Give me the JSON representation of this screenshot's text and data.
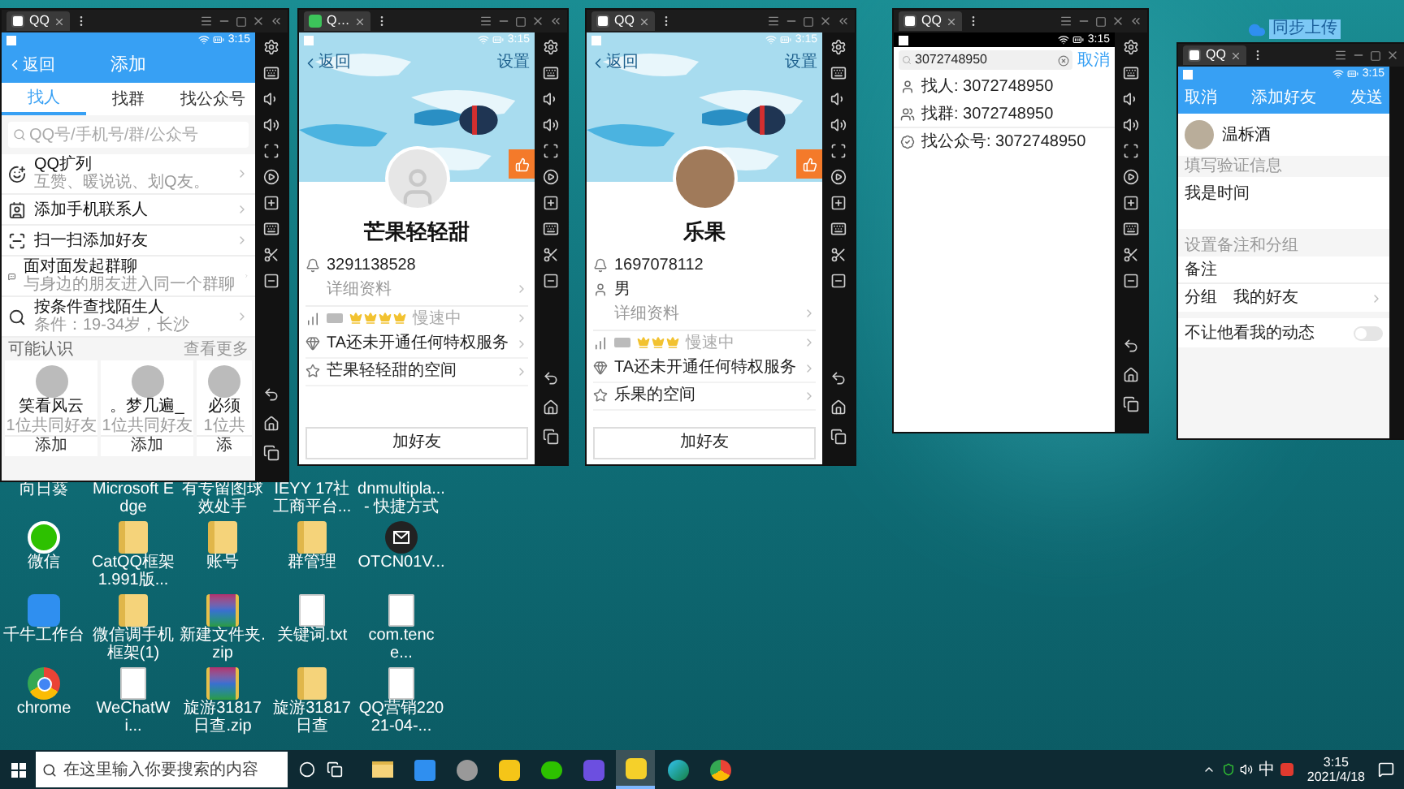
{
  "sync_button": {
    "label": "同步上传"
  },
  "windows": [
    {
      "kind": "add",
      "tab": "QQ",
      "app_icon": {
        "kind": "qq"
      },
      "time": "3:15",
      "back": "返回",
      "title": "添加",
      "tabs": [
        {
          "label": "找人",
          "selected": true
        },
        {
          "label": "找群",
          "selected": false
        },
        {
          "label": "找公众号",
          "selected": false
        }
      ],
      "search_placeholder": "QQ号/手机号/群/公众号",
      "items": [
        {
          "kind": "expand",
          "title": "QQ扩列",
          "subtitle": "互赞、暖说说、划Q友。"
        },
        {
          "kind": "contacts",
          "title": "添加手机联系人"
        },
        {
          "kind": "scan",
          "title": "扫一扫添加好友"
        },
        {
          "kind": "chat",
          "title": "面对面发起群聊",
          "subtitle": "与身边的朋友进入同一个群聊"
        },
        {
          "kind": "search",
          "title": "按条件查找陌生人",
          "subtitle": "条件：19-34岁，长沙"
        }
      ],
      "section": "可能认识",
      "more": "查看更多",
      "people": [
        {
          "name": "笑看风云",
          "mutual": "1位共同好友",
          "action": "添加"
        },
        {
          "name": "。梦几遍_",
          "mutual": "1位共同好友",
          "action": "添加"
        },
        {
          "name": "必须",
          "mutual": "1位共",
          "action": "添"
        }
      ]
    },
    {
      "kind": "profile",
      "tab": "Q…",
      "app_icon": {
        "kind": "green"
      },
      "time": "3:15",
      "back": "返回",
      "settings": "设置",
      "name": "芒果轻轻甜",
      "avatar": {
        "kind": "default"
      },
      "info": [
        {
          "kind": "qq",
          "text": "3291138528"
        },
        {
          "kind": "detail",
          "text": "详细资料"
        }
      ],
      "level": {
        "stars": 4,
        "status": "慢速中"
      },
      "links": [
        {
          "kind": "privilege",
          "text": "TA还未开通任何特权服务"
        },
        {
          "kind": "space",
          "text": "芒果轻轻甜的空间"
        }
      ],
      "add_button": "加好友"
    },
    {
      "kind": "profile",
      "tab": "QQ",
      "app_icon": {
        "kind": "qq"
      },
      "time": "3:15",
      "back": "返回",
      "settings": "设置",
      "name": "乐果",
      "avatar": {
        "kind": "photo"
      },
      "info": [
        {
          "kind": "qq",
          "text": "1697078112"
        },
        {
          "kind": "gender",
          "text": "男"
        },
        {
          "kind": "detail",
          "text": "详细资料"
        }
      ],
      "level": {
        "stars": 3,
        "status": "慢速中"
      },
      "links": [
        {
          "kind": "privilege",
          "text": "TA还未开通任何特权服务"
        },
        {
          "kind": "space",
          "text": "乐果的空间"
        }
      ],
      "add_button": "加好友"
    },
    {
      "kind": "search",
      "tab": "QQ",
      "app_icon": {
        "kind": "qq"
      },
      "time": "3:15",
      "query": "3072748950",
      "cancel": "取消",
      "results": [
        {
          "kind": "person",
          "text": "找人: 3072748950"
        },
        {
          "kind": "group",
          "text": "找群: 3072748950"
        },
        {
          "kind": "official",
          "text": "找公众号: 3072748950"
        }
      ]
    },
    {
      "kind": "add_friend",
      "tab": "QQ",
      "app_icon": {
        "kind": "qq"
      },
      "time": "3:15",
      "cancel": "取消",
      "title": "添加好友",
      "send": "发送",
      "name": "温柝酒",
      "verify_label": "填写验证信息",
      "verify_text": "我是时间",
      "group_label": "设置备注和分组",
      "remark": "备注",
      "group_key": "分组",
      "group_value": "我的好友",
      "hide_label": "不让他看我的动态",
      "hide_on": false
    }
  ],
  "desktop_icons": [
    {
      "label": "向日葵",
      "kind": "covered"
    },
    {
      "label": "Microsoft Edge",
      "kind": "covered"
    },
    {
      "label": "有专留图球效处手",
      "kind": "covered"
    },
    {
      "label": "IEYY 17社工商平台...",
      "kind": "covered"
    },
    {
      "label": "dnmultipla... - 快捷方式",
      "kind": "covered"
    },
    {
      "label": "微信",
      "kind": "wechat"
    },
    {
      "label": "CatQQ框架1.991版...",
      "kind": "folder"
    },
    {
      "label": "账号",
      "kind": "folder"
    },
    {
      "label": "群管理",
      "kind": "folder"
    },
    {
      "label": "OTCN01V...",
      "kind": "mail"
    },
    {
      "label": "千牛工作台",
      "kind": "app"
    },
    {
      "label": "微信调手机框架(1)",
      "kind": "folder"
    },
    {
      "label": "新建文件夹.zip",
      "kind": "archive"
    },
    {
      "label": "关键词.txt",
      "kind": "file"
    },
    {
      "label": "com.tence...",
      "kind": "file"
    },
    {
      "label": "chrome",
      "kind": "browser"
    },
    {
      "label": "WeChatWi...",
      "kind": "file"
    },
    {
      "label": "旋游31817日查.zip",
      "kind": "archive"
    },
    {
      "label": "旋游31817日查",
      "kind": "folder"
    },
    {
      "label": "QQ营销22021-04-...",
      "kind": "file"
    }
  ],
  "taskbar": {
    "search_placeholder": "在这里输入你要搜索的内容",
    "apps": [
      {
        "kind": "explorer",
        "selected": false
      },
      {
        "kind": "u_app",
        "selected": false
      },
      {
        "kind": "avatar",
        "selected": false
      },
      {
        "kind": "yellow_app",
        "selected": false
      },
      {
        "kind": "wechat",
        "selected": false
      },
      {
        "kind": "d_app",
        "selected": false
      },
      {
        "kind": "qq_app",
        "selected": true
      },
      {
        "kind": "edge",
        "selected": false
      },
      {
        "kind": "chrome",
        "selected": false
      }
    ],
    "ime": "中",
    "time": "3:15",
    "date": "2021/4/18"
  }
}
